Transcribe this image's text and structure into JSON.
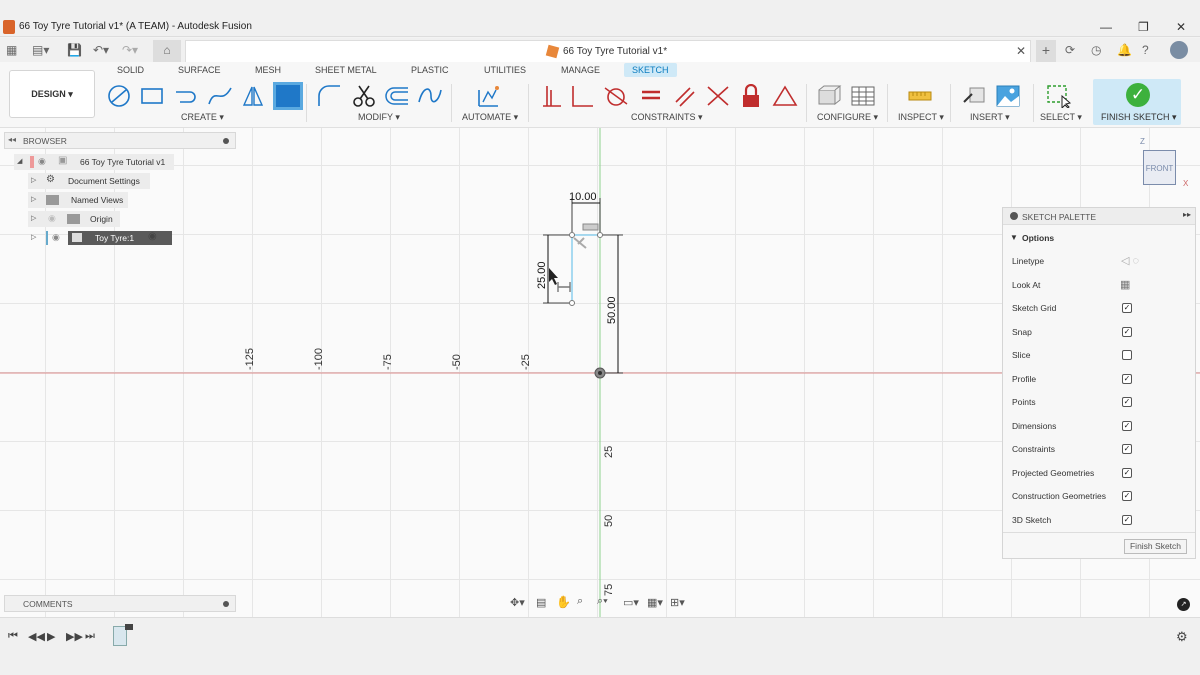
{
  "window": {
    "title": "66 Toy Tyre Tutorial v1* (A TEAM) - Autodesk Fusion"
  },
  "doc_tab": {
    "name": "66 Toy Tyre Tutorial v1*"
  },
  "workspace": {
    "label": "DESIGN ▾"
  },
  "ribbon_tabs": [
    "SOLID",
    "SURFACE",
    "MESH",
    "SHEET METAL",
    "PLASTIC",
    "UTILITIES",
    "MANAGE",
    "SKETCH"
  ],
  "active_tab": "SKETCH",
  "groups": {
    "create": "CREATE ▾",
    "modify": "MODIFY ▾",
    "automate": "AUTOMATE ▾",
    "constraints": "CONSTRAINTS ▾",
    "configure": "CONFIGURE ▾",
    "inspect": "INSPECT ▾",
    "insert": "INSERT ▾",
    "select": "SELECT ▾",
    "finish": "FINISH SKETCH ▾"
  },
  "browser": {
    "title": "BROWSER",
    "items": [
      {
        "label": "66 Toy Tyre Tutorial v1"
      },
      {
        "label": "Document Settings"
      },
      {
        "label": "Named Views"
      },
      {
        "label": "Origin"
      },
      {
        "label": "Toy Tyre:1"
      }
    ]
  },
  "dimensions": {
    "top": "10.00",
    "left": "25.00",
    "right": "50.00"
  },
  "axis_ticks": {
    "neg": [
      "-125",
      "-100",
      "-75",
      "-50",
      "-25"
    ],
    "pos": [
      "25",
      "50",
      "75"
    ]
  },
  "viewcube": {
    "face": "FRONT",
    "z": "Z",
    "x": "X"
  },
  "palette": {
    "title": "SKETCH PALETTE",
    "section": "Options",
    "rows": [
      {
        "label": "Linetype",
        "kind": "icons"
      },
      {
        "label": "Look At",
        "kind": "icon"
      },
      {
        "label": "Sketch Grid",
        "checked": true
      },
      {
        "label": "Snap",
        "checked": true
      },
      {
        "label": "Slice",
        "checked": false
      },
      {
        "label": "Profile",
        "checked": true
      },
      {
        "label": "Points",
        "checked": true
      },
      {
        "label": "Dimensions",
        "checked": true
      },
      {
        "label": "Constraints",
        "checked": true
      },
      {
        "label": "Projected Geometries",
        "checked": true
      },
      {
        "label": "Construction Geometries",
        "checked": true
      },
      {
        "label": "3D Sketch",
        "checked": true
      }
    ],
    "finish_button": "Finish Sketch"
  },
  "comments": {
    "title": "COMMENTS"
  },
  "colors": {
    "accent": "#0a7cbf",
    "finish_green": "#3db13d",
    "x_axis": "#d98b8b",
    "y_axis": "#8ed28e"
  }
}
